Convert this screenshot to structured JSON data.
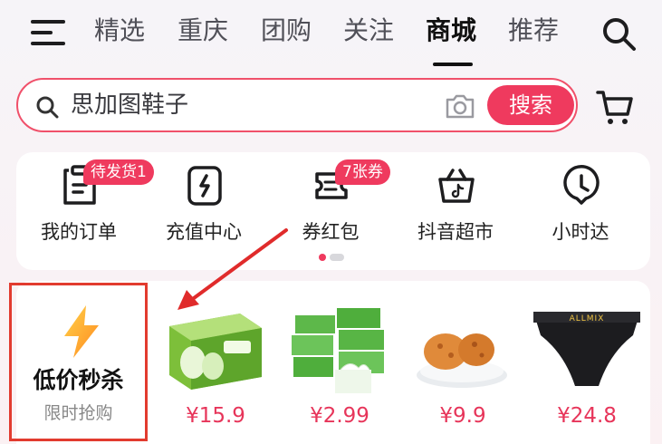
{
  "nav": {
    "menu_icon": "menu-icon",
    "tabs": [
      {
        "label": "精选"
      },
      {
        "label": "重庆"
      },
      {
        "label": "团购"
      },
      {
        "label": "关注"
      },
      {
        "label": "商城",
        "active": true
      },
      {
        "label": "推荐"
      }
    ],
    "search_icon": "search-icon"
  },
  "search": {
    "placeholder": "思加图鞋子",
    "button_label": "搜索",
    "camera_icon": "camera-icon",
    "cart_icon": "cart-icon"
  },
  "quick_entries": [
    {
      "label": "我的订单",
      "icon": "order-icon",
      "badge": "待发货1"
    },
    {
      "label": "充值中心",
      "icon": "recharge-icon"
    },
    {
      "label": "券红包",
      "icon": "coupon-icon",
      "badge": "7张券"
    },
    {
      "label": "抖音超市",
      "icon": "supermarket-icon"
    },
    {
      "label": "小时达",
      "icon": "clock-icon"
    }
  ],
  "pager": {
    "pages": 2,
    "current": 1
  },
  "flash_sale": {
    "title": "低价秒杀",
    "subtitle": "限时抢购",
    "icon": "lightning-icon"
  },
  "products": [
    {
      "price": "¥15.9",
      "image": "yogurt-box"
    },
    {
      "price": "¥2.99",
      "image": "tissue-packs"
    },
    {
      "price": "¥9.9",
      "image": "pastry-plate"
    },
    {
      "price": "¥24.8",
      "image": "underwear",
      "image_text": "ALLMIX"
    }
  ],
  "colors": {
    "accent": "#ef3a5e",
    "highlight_box": "#e23b2f",
    "price": "#e7355a"
  }
}
